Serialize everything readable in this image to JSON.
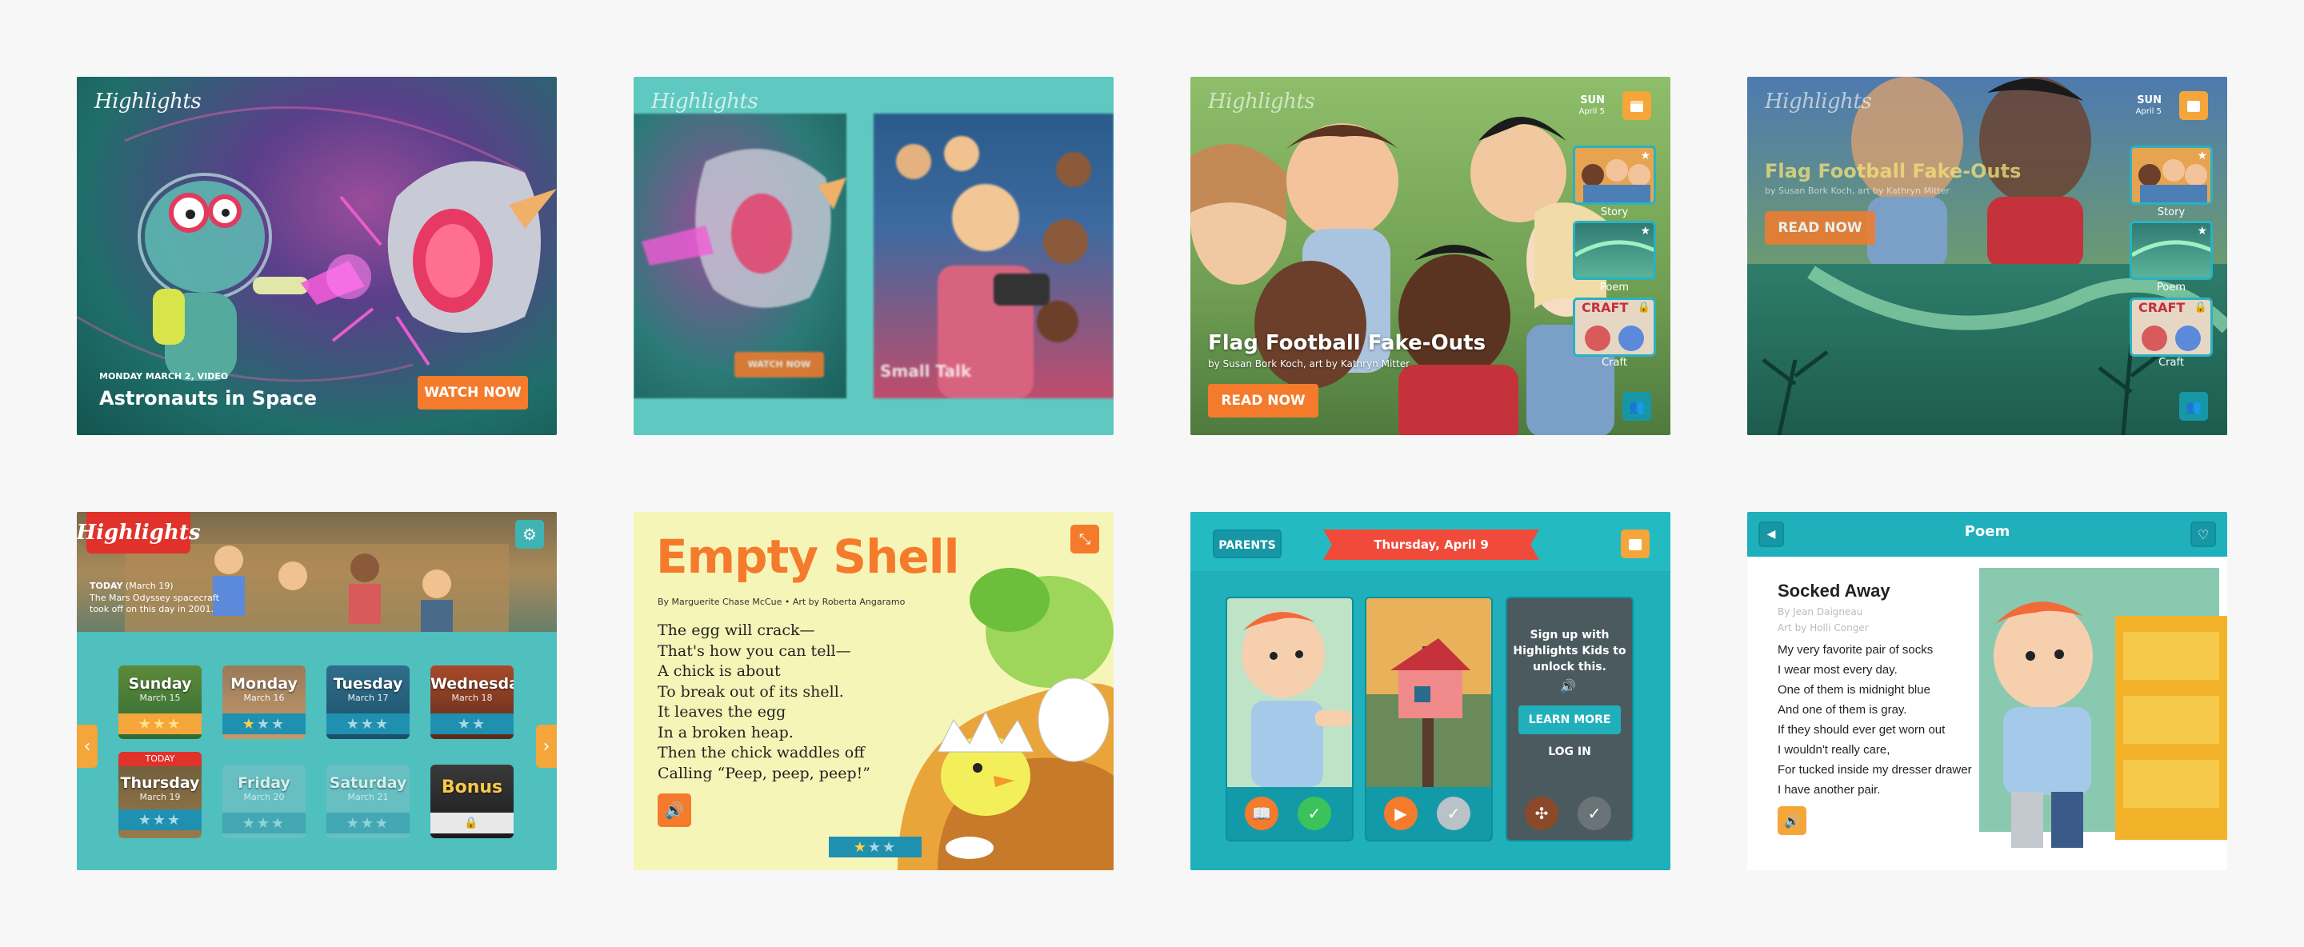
{
  "screen1": {
    "logo": "Highlights",
    "date": "MONDAY MARCH 2, VIDEO",
    "title": "Astronauts in Space",
    "button": "WATCH NOW"
  },
  "screen2": {
    "logo": "Highlights",
    "button": "WATCH NOW",
    "caption": "Small Talk"
  },
  "screen3": {
    "logo": "Highlights",
    "day": "SUN",
    "date": "April 5",
    "title": "Flag Football Fake-Outs",
    "byline": "by Susan Bork Koch, art by Kathryn Mitter",
    "button": "READ NOW",
    "thumbs": [
      {
        "label": "Story"
      },
      {
        "label": "Poem"
      },
      {
        "label": "Craft",
        "text": "CRAFT"
      }
    ]
  },
  "screen4": {
    "logo": "Highlights",
    "day": "SUN",
    "date": "April 5",
    "title": "Flag Football Fake-Outs",
    "byline": "by Susan Bork Koch, art by Kathryn Mitter",
    "button": "READ NOW",
    "thumbs": [
      {
        "label": "Story"
      },
      {
        "label": "Poem"
      },
      {
        "label": "Craft",
        "text": "CRAFT"
      }
    ]
  },
  "screen5": {
    "logo": "Highlights",
    "today_label": "TODAY",
    "today_date": "(March 19)",
    "today_text_1": "The Mars Odyssey spacecraft",
    "today_text_2": "took off on this day in 2001.",
    "today_badge": "TODAY",
    "days": [
      {
        "name": "Sunday",
        "date": "March 15",
        "stars": "★★★"
      },
      {
        "name": "Monday",
        "date": "March 16",
        "stars": "★★★"
      },
      {
        "name": "Tuesday",
        "date": "March 17",
        "stars": "★★★"
      },
      {
        "name": "Wednesday",
        "date": "March 18",
        "stars": "★★"
      },
      {
        "name": "Thursday",
        "date": "March 19",
        "stars": "★★★"
      },
      {
        "name": "Friday",
        "date": "March 20",
        "stars": "★★★"
      },
      {
        "name": "Saturday",
        "date": "March 21",
        "stars": "★★★"
      },
      {
        "name": "Bonus",
        "date": "",
        "stars": ""
      }
    ]
  },
  "screen6": {
    "title": "Empty Shell",
    "byline": "By Marguerite Chase McCue  •  Art by Roberta Angaramo",
    "lines": [
      "The egg will crack—",
      "That's how you can tell—",
      "A chick is about",
      "To break out of its shell.",
      "It leaves the egg",
      "In a broken heap.",
      "Then the chick waddles off",
      "Calling “Peep, peep, peep!”"
    ],
    "rating": "★★★"
  },
  "screen7": {
    "parents": "PARENTS",
    "date": "Thursday, April 9",
    "signup_1": "Sign up with",
    "signup_2": "Highlights Kids to",
    "signup_3": "unlock this.",
    "learn_more": "LEARN MORE",
    "log_in": "LOG IN"
  },
  "screen8": {
    "header": "Poem",
    "title": "Socked Away",
    "author": "By Jean Daigneau",
    "art": "Art by Holli Conger",
    "lines": [
      "My very favorite pair of socks",
      "I wear most every day.",
      "One of them is midnight blue",
      "And one of them is gray.",
      "If they should ever get worn out",
      "I wouldn't really care,",
      "For tucked inside my dresser drawer",
      "I have another pair."
    ]
  },
  "colors": {
    "orange": "#f47b2c",
    "teal": "#2ab1c2",
    "dark_teal": "#0d8f9d",
    "highlights_red": "#e0322b"
  }
}
